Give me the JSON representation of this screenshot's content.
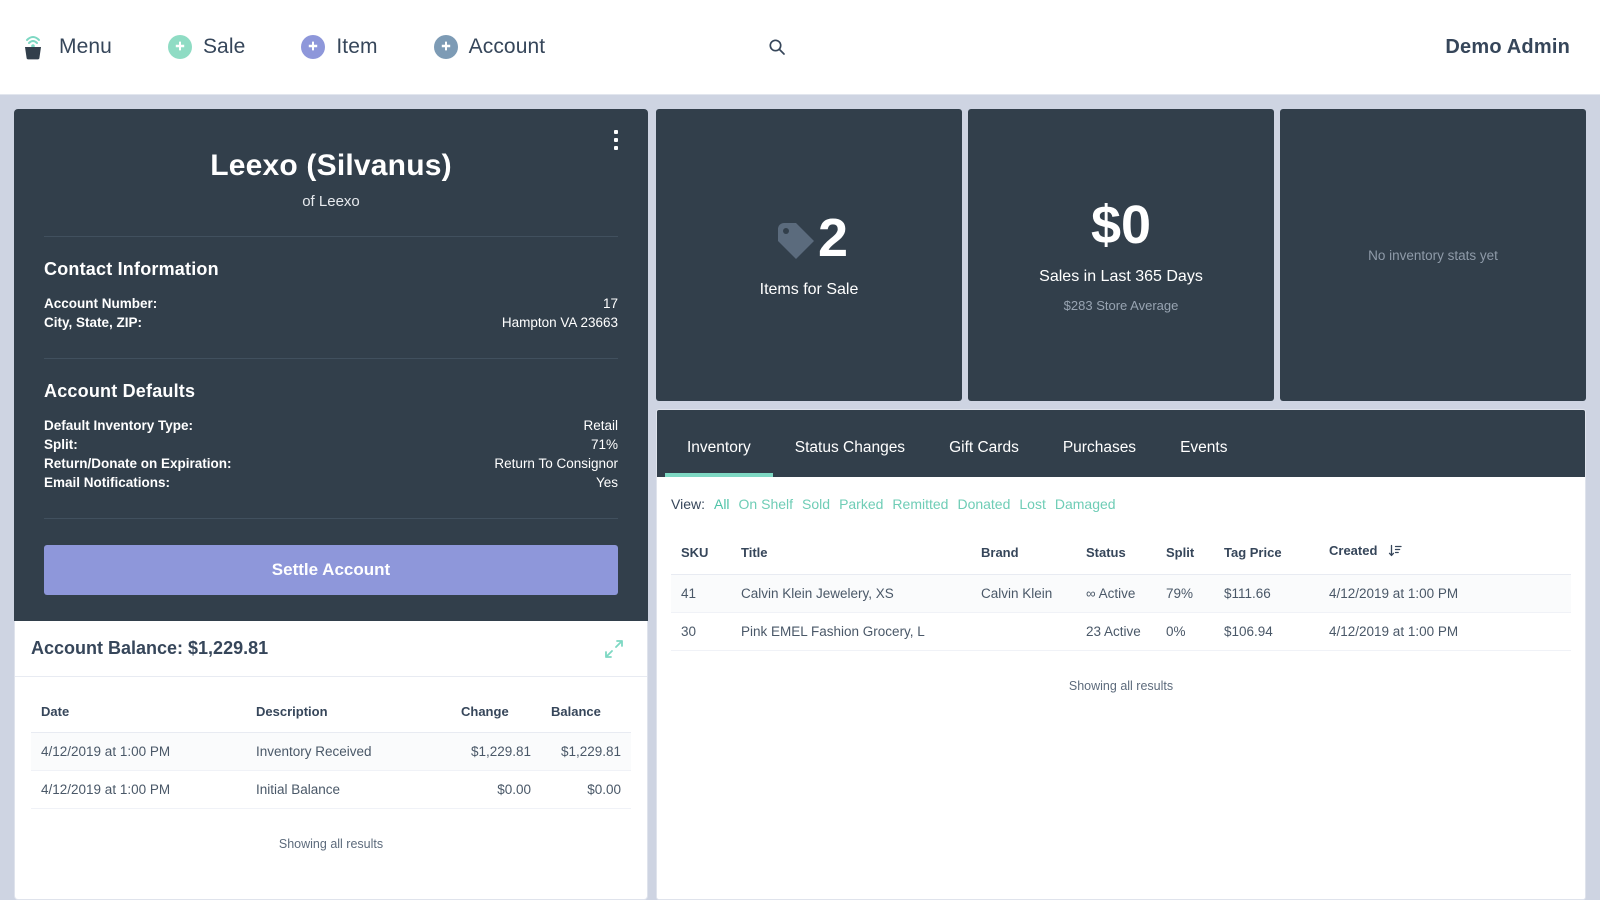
{
  "topnav": {
    "brand_icon": "shopping-bag-signal-icon",
    "items": [
      {
        "label": "Menu",
        "icon": "shopping-bag-signal-icon",
        "color": "#323f4b"
      },
      {
        "label": "Sale",
        "icon": "plus-circle-icon",
        "color": "#8fdcc4"
      },
      {
        "label": "Item",
        "icon": "plus-circle-icon",
        "color": "#8e97da"
      },
      {
        "label": "Account",
        "icon": "plus-circle-icon",
        "color": "#7d9bb5"
      }
    ],
    "search_icon": "search-icon",
    "user": "Demo Admin"
  },
  "profile": {
    "menu_icon": "kebab-menu-icon",
    "title": "Leexo (Silvanus)",
    "subtitle": "of Leexo",
    "contact_heading": "Contact Information",
    "contact_rows": [
      {
        "key": "Account Number:",
        "value": "17"
      },
      {
        "key": "City, State, ZIP:",
        "value": "Hampton VA 23663"
      }
    ],
    "defaults_heading": "Account Defaults",
    "defaults_rows": [
      {
        "key": "Default Inventory Type:",
        "value": "Retail"
      },
      {
        "key": "Split:",
        "value": "71%"
      },
      {
        "key": "Return/Donate on Expiration:",
        "value": "Return To Consignor"
      },
      {
        "key": "Email Notifications:",
        "value": "Yes"
      }
    ],
    "settle_label": "Settle Account"
  },
  "balance": {
    "title": "Account Balance: $1,229.81",
    "expand_icon": "expand-diagonal-icon",
    "columns": [
      "Date",
      "Description",
      "Change",
      "Balance"
    ],
    "rows": [
      {
        "date": "4/12/2019 at 1:00 PM",
        "description": "Inventory Received",
        "change": "$1,229.81",
        "balance": "$1,229.81"
      },
      {
        "date": "4/12/2019 at 1:00 PM",
        "description": "Initial Balance",
        "change": "$0.00",
        "balance": "$0.00"
      }
    ],
    "footer": "Showing all results"
  },
  "stats": [
    {
      "icon": "price-tag-icon",
      "value": "2",
      "label": "Items for Sale",
      "sub": ""
    },
    {
      "icon": "",
      "value": "$0",
      "label": "Sales in Last 365 Days",
      "sub": "$283 Store Average"
    },
    {
      "icon": "",
      "value": "",
      "label": "",
      "sub": "",
      "empty": "No inventory stats yet"
    }
  ],
  "panel": {
    "tabs": [
      {
        "label": "Inventory",
        "active": true
      },
      {
        "label": "Status Changes",
        "active": false
      },
      {
        "label": "Gift Cards",
        "active": false
      },
      {
        "label": "Purchases",
        "active": false
      },
      {
        "label": "Events",
        "active": false
      }
    ],
    "view_label": "View:",
    "view_filters": [
      {
        "label": "All",
        "selected": true
      },
      {
        "label": "On Shelf",
        "selected": false
      },
      {
        "label": "Sold",
        "selected": false
      },
      {
        "label": "Parked",
        "selected": false
      },
      {
        "label": "Remitted",
        "selected": false
      },
      {
        "label": "Donated",
        "selected": false
      },
      {
        "label": "Lost",
        "selected": false
      },
      {
        "label": "Damaged",
        "selected": false
      }
    ],
    "columns": [
      "SKU",
      "Title",
      "Brand",
      "Status",
      "Split",
      "Tag Price",
      "Created"
    ],
    "sort_icon": "sort-descending-icon",
    "rows": [
      {
        "sku": "41",
        "title": "Calvin Klein Jewelery, XS",
        "brand": "Calvin Klein",
        "status": "∞ Active",
        "split": "79%",
        "tag_price": "$111.66",
        "created": "4/12/2019 at 1:00 PM"
      },
      {
        "sku": "30",
        "title": "Pink EMEL Fashion Grocery, L",
        "brand": "",
        "status": "23 Active",
        "split": "0%",
        "tag_price": "$106.94",
        "created": "4/12/2019 at 1:00 PM"
      }
    ],
    "footer": "Showing all results"
  },
  "colors": {
    "page_bg": "#ced4e2",
    "dark_panel": "#323f4b",
    "accent_teal": "#6fcdb6",
    "accent_purple": "#8e97da",
    "text_dark": "#36465a"
  }
}
